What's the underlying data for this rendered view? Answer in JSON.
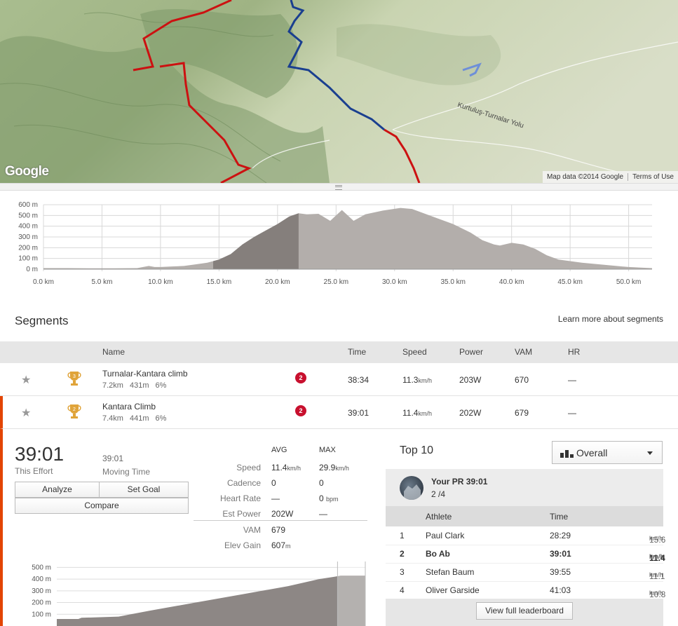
{
  "map": {
    "logo": "Google",
    "attribution": "Map data ©2014 Google",
    "terms": "Terms of Use",
    "road_label": "Kurtuluş-Turnalar Yolu"
  },
  "elevation_chart": {
    "type": "area",
    "y_ticks": [
      "600 m",
      "500 m",
      "400 m",
      "300 m",
      "200 m",
      "100 m",
      "0 m"
    ],
    "x_ticks": [
      "0.0 km",
      "5.0 km",
      "10.0 km",
      "15.0 km",
      "20.0 km",
      "25.0 km",
      "30.0 km",
      "35.0 km",
      "40.0 km",
      "45.0 km",
      "50.0 km"
    ],
    "ylim": [
      0,
      600
    ],
    "xlim": [
      0,
      52
    ],
    "highlight_range_km": [
      14.5,
      21.8
    ],
    "profile": [
      [
        0,
        10
      ],
      [
        2,
        10
      ],
      [
        4,
        8
      ],
      [
        6,
        8
      ],
      [
        8,
        10
      ],
      [
        9,
        30
      ],
      [
        9.5,
        20
      ],
      [
        10,
        20
      ],
      [
        11,
        25
      ],
      [
        12,
        30
      ],
      [
        13,
        45
      ],
      [
        14,
        60
      ],
      [
        15,
        90
      ],
      [
        16,
        140
      ],
      [
        17,
        230
      ],
      [
        18,
        300
      ],
      [
        19,
        360
      ],
      [
        20,
        420
      ],
      [
        21,
        490
      ],
      [
        21.8,
        520
      ],
      [
        22.5,
        510
      ],
      [
        23.5,
        515
      ],
      [
        24.5,
        450
      ],
      [
        25.5,
        550
      ],
      [
        26.5,
        450
      ],
      [
        27.5,
        510
      ],
      [
        29,
        545
      ],
      [
        30.5,
        570
      ],
      [
        31.5,
        560
      ],
      [
        33,
        500
      ],
      [
        35,
        420
      ],
      [
        36.5,
        340
      ],
      [
        37.5,
        270
      ],
      [
        38.5,
        230
      ],
      [
        39,
        220
      ],
      [
        40,
        245
      ],
      [
        41,
        230
      ],
      [
        42,
        190
      ],
      [
        43,
        130
      ],
      [
        44,
        90
      ],
      [
        46,
        60
      ],
      [
        48,
        40
      ],
      [
        50,
        20
      ],
      [
        52,
        10
      ]
    ]
  },
  "segments": {
    "title": "Segments",
    "learn_more": "Learn more about segments",
    "headers": {
      "name": "Name",
      "time": "Time",
      "speed": "Speed",
      "power": "Power",
      "vam": "VAM",
      "hr": "HR"
    },
    "rows": [
      {
        "name": "Turnalar-Kantara climb",
        "dist": "7.2km",
        "elev": "431m",
        "grade": "6%",
        "trophy_rank": "3",
        "badge": "2",
        "time": "38:34",
        "speed": "11.3",
        "speed_unit": "km/h",
        "power": "203W",
        "vam": "670",
        "hr": "—"
      },
      {
        "name": "Kantara Climb",
        "dist": "7.4km",
        "elev": "441m",
        "grade": "6%",
        "trophy_rank": "2",
        "badge": "2",
        "time": "39:01",
        "speed": "11.4",
        "speed_unit": "km/h",
        "power": "202W",
        "vam": "679",
        "hr": "—"
      }
    ]
  },
  "detail": {
    "effort_time": "39:01",
    "effort_label": "This Effort",
    "moving_time": "39:01",
    "moving_label": "Moving Time",
    "buttons": {
      "analyze": "Analyze",
      "set_goal": "Set Goal",
      "compare": "Compare"
    },
    "stats": {
      "avg_header": "AVG",
      "max_header": "MAX",
      "speed_label": "Speed",
      "speed_avg": "11.4",
      "speed_avg_unit": "km/h",
      "speed_max": "29.9",
      "speed_max_unit": "km/h",
      "cadence_label": "Cadence",
      "cadence_avg": "0",
      "cadence_max": "0",
      "hr_label": "Heart Rate",
      "hr_avg": "—",
      "hr_max": "0",
      "hr_max_unit": "bpm",
      "power_label": "Est Power",
      "power_avg": "202W",
      "power_max": "—",
      "vam_label": "VAM",
      "vam_value": "679",
      "gain_label": "Elev Gain",
      "gain_value": "607",
      "gain_unit": "m"
    },
    "mini_chart": {
      "y_ticks": [
        "500 m",
        "400 m",
        "300 m",
        "200 m",
        "100 m"
      ],
      "ylim": [
        0,
        550
      ],
      "profile": [
        [
          0,
          60
        ],
        [
          0.07,
          60
        ],
        [
          0.08,
          70
        ],
        [
          0.2,
          80
        ],
        [
          0.3,
          130
        ],
        [
          0.45,
          200
        ],
        [
          0.6,
          270
        ],
        [
          0.75,
          340
        ],
        [
          0.85,
          400
        ],
        [
          0.9,
          420
        ],
        [
          0.92,
          430
        ],
        [
          1,
          430
        ]
      ],
      "highlight_from": 0.91
    }
  },
  "top10": {
    "title": "Top 10",
    "filter": "Overall",
    "pr_title": "Your PR 39:01",
    "pr_rank": "2",
    "pr_of": "/4",
    "headers": {
      "athlete": "Athlete",
      "time": "Time"
    },
    "rows": [
      {
        "rank": "1",
        "athlete": "Paul Clark",
        "time": "28:29",
        "speed": "15.6",
        "unit": "km/h",
        "me": false
      },
      {
        "rank": "2",
        "athlete": "Bo Ab",
        "time": "39:01",
        "speed": "11.4",
        "unit": "km/h",
        "me": true
      },
      {
        "rank": "3",
        "athlete": "Stefan Baum",
        "time": "39:55",
        "speed": "11.1",
        "unit": "km/h",
        "me": false
      },
      {
        "rank": "4",
        "athlete": "Oliver Garside",
        "time": "41:03",
        "speed": "10.8",
        "unit": "km/h",
        "me": false
      }
    ],
    "view_full": "View full leaderboard"
  }
}
